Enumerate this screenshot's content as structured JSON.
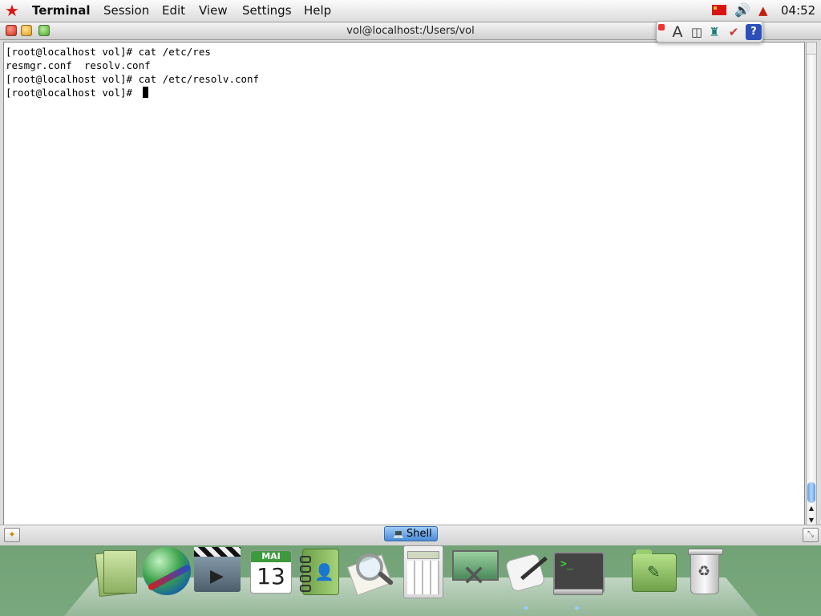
{
  "menubar": {
    "app_name": "Terminal",
    "menus": [
      "Session",
      "Edit",
      "View",
      "Settings",
      "Help"
    ],
    "clock": "04:52"
  },
  "window": {
    "title": "vol@localhost:/Users/vol"
  },
  "keyboard_toolbar": {
    "font_glyph": "A",
    "help_glyph": "?"
  },
  "terminal": {
    "lines": [
      "[root@localhost vol]# cat /etc/res",
      "resmgr.conf  resolv.conf",
      "[root@localhost vol]# cat /etc/resolv.conf",
      "[root@localhost vol]# "
    ]
  },
  "tabs": [
    {
      "label": "Shell"
    }
  ],
  "dock": {
    "calendar_month": "MAI",
    "calendar_day": "13",
    "terminal_prompt": ">_"
  },
  "colors": {
    "menubar_star": "#d81414",
    "active_tab": "#6ea8ec",
    "scroll_thumb": "#5b9be0"
  }
}
